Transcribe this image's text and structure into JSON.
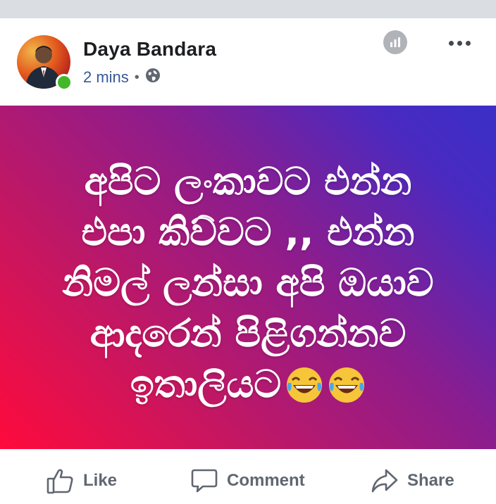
{
  "post": {
    "author": "Daya Bandara",
    "time": "2 mins",
    "separator": "•",
    "privacy_icon": "globe-icon",
    "image_text_lines": [
      "අපිට ලංකාවට එන්න",
      "එපා කිව්වට ,, එන්න",
      "නිමල් ලන්සා අපි ඔයාව",
      "ආදරෙන් පිළිගන්නව",
      "ඉතාලියට"
    ],
    "emoji": "face-with-tears-of-joy"
  },
  "actions": {
    "like": "Like",
    "comment": "Comment",
    "share": "Share"
  },
  "colors": {
    "name": "#1c1e21",
    "meta_link": "#385898",
    "action_gray": "#606770",
    "online": "#42b72a",
    "gradient_start": "#ff0a3c",
    "gradient_end": "#3a2fc8"
  }
}
